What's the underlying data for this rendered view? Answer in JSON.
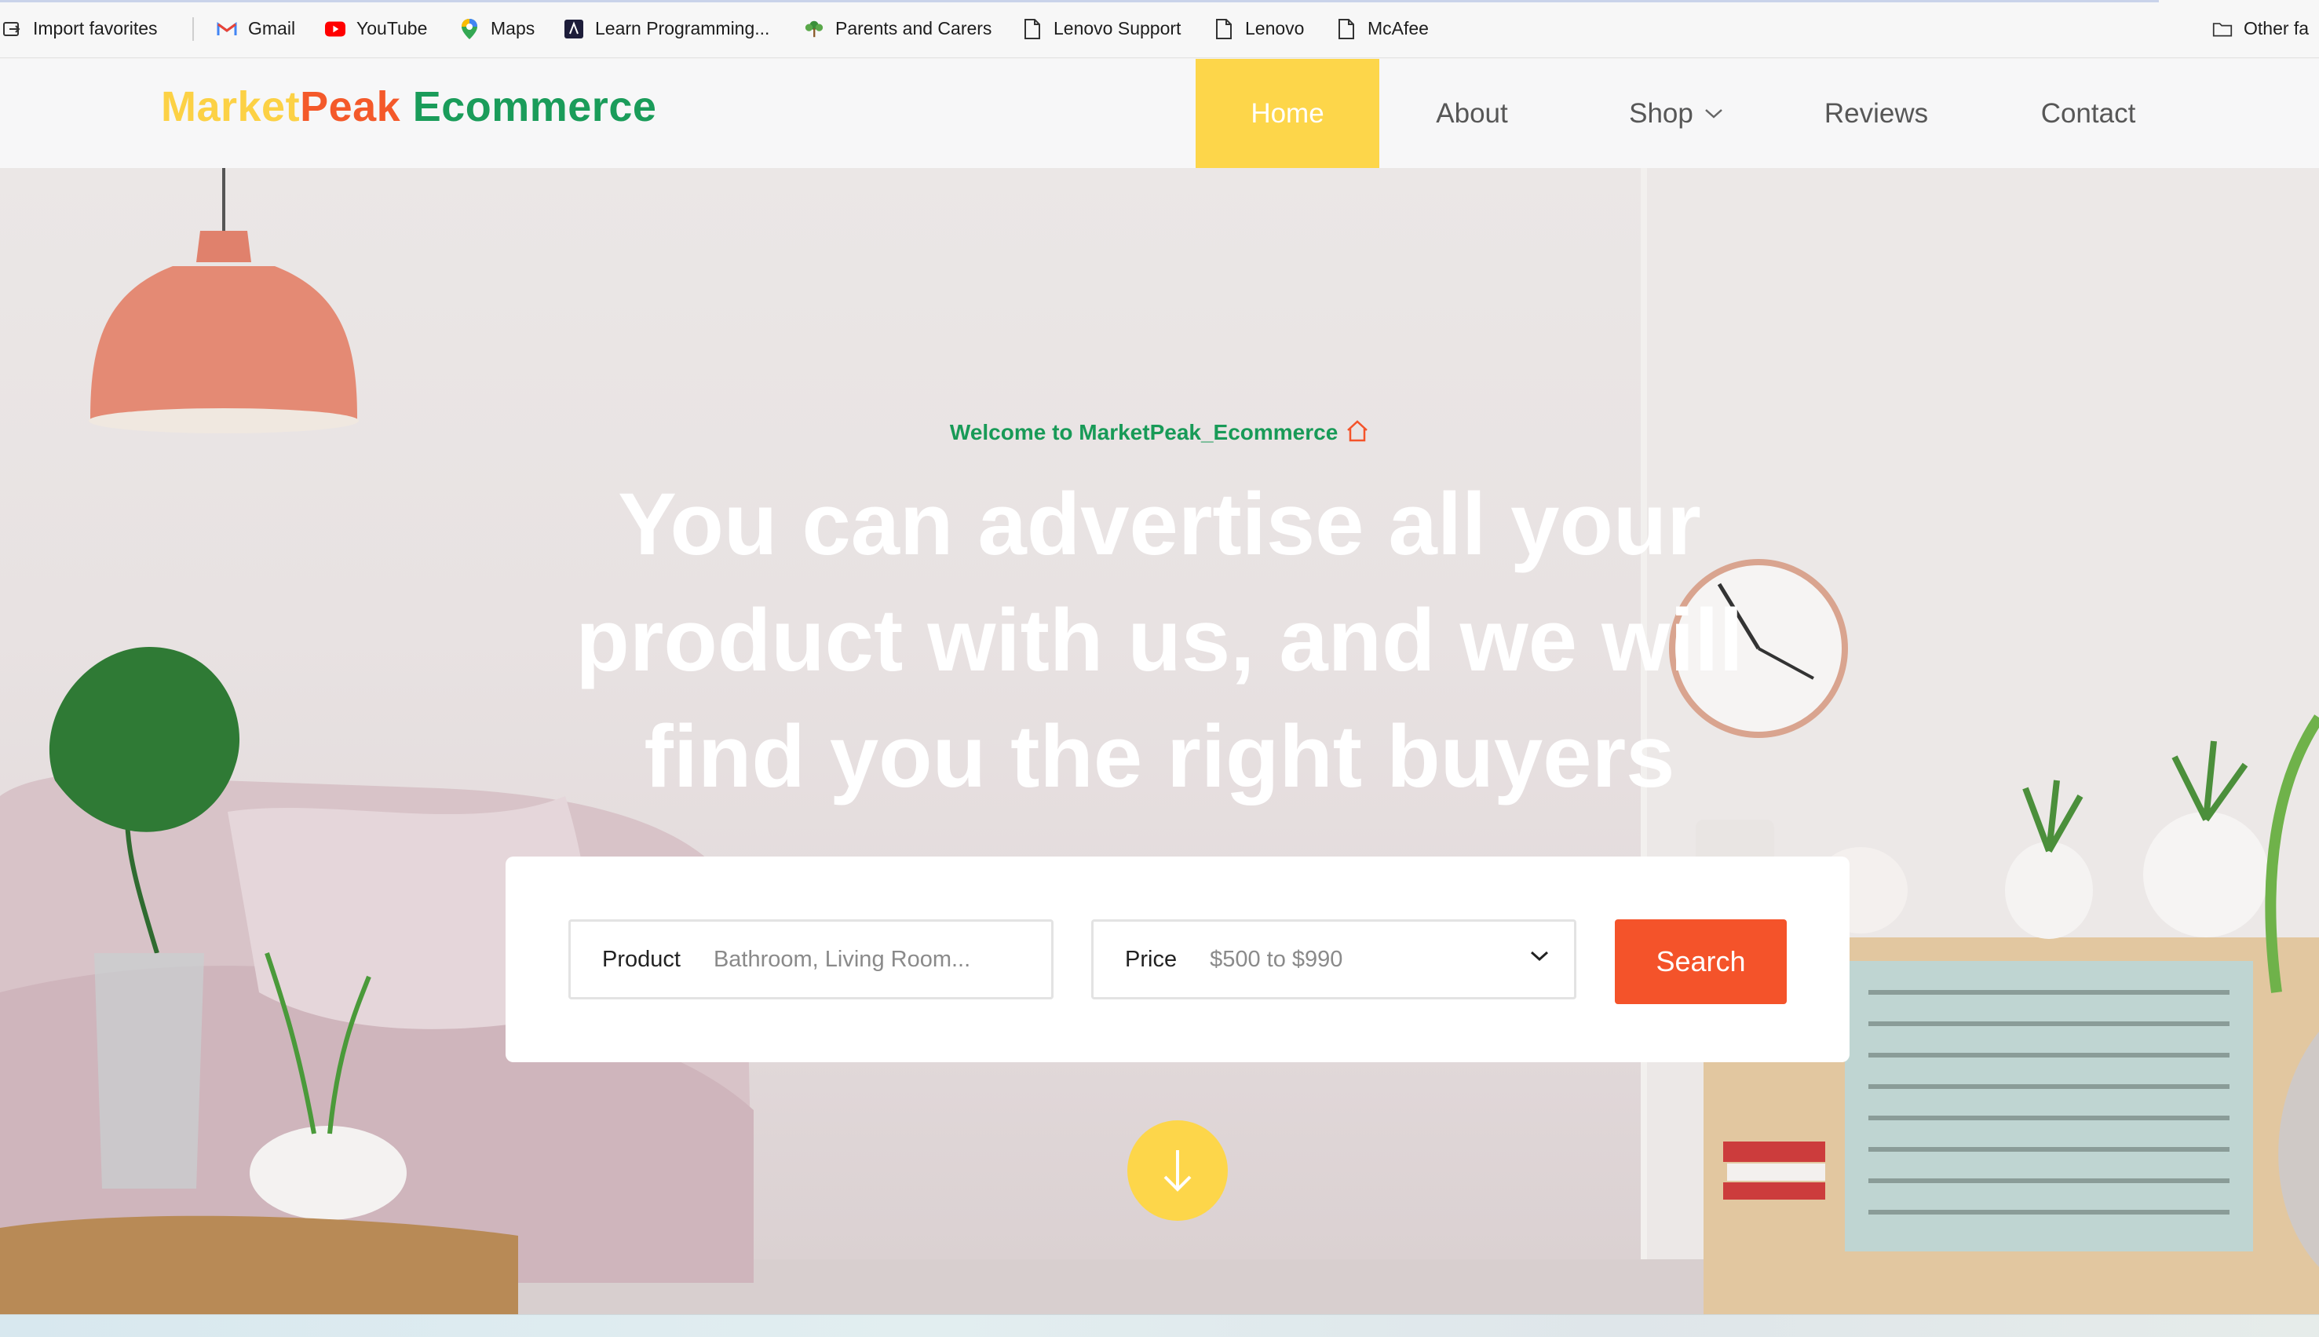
{
  "bookmarks": [
    {
      "label": "Import favorites",
      "icon": "import-icon"
    },
    {
      "label": "Gmail",
      "icon": "gmail-icon"
    },
    {
      "label": "YouTube",
      "icon": "youtube-icon"
    },
    {
      "label": "Maps",
      "icon": "maps-pin-icon"
    },
    {
      "label": "Learn Programming...",
      "icon": "code-icon"
    },
    {
      "label": "Parents and Carers",
      "icon": "tree-icon"
    },
    {
      "label": "Lenovo Support",
      "icon": "page-icon"
    },
    {
      "label": "Lenovo",
      "icon": "page-icon"
    },
    {
      "label": "McAfee",
      "icon": "page-icon"
    }
  ],
  "other_favorites": {
    "label": "Other fa",
    "icon": "folder-icon"
  },
  "logo": {
    "part1": "Market",
    "part2": "Peak",
    "part3": " Ecommerce"
  },
  "nav": {
    "home": "Home",
    "about": "About",
    "shop": "Shop",
    "reviews": "Reviews",
    "contact": "Contact"
  },
  "hero": {
    "welcome": "Welcome to MarketPeak_Ecommerce",
    "headline_lines": [
      "You can advertise all your",
      "product with us, and we will",
      "find you the right buyers"
    ]
  },
  "search": {
    "product_label": "Product",
    "product_placeholder": "Bathroom, Living Room...",
    "price_label": "Price",
    "price_value": "$500 to $990",
    "button": "Search"
  },
  "colors": {
    "brand_yellow": "#fdd64a",
    "brand_orange": "#f4532a",
    "brand_green": "#1a9c5a"
  }
}
